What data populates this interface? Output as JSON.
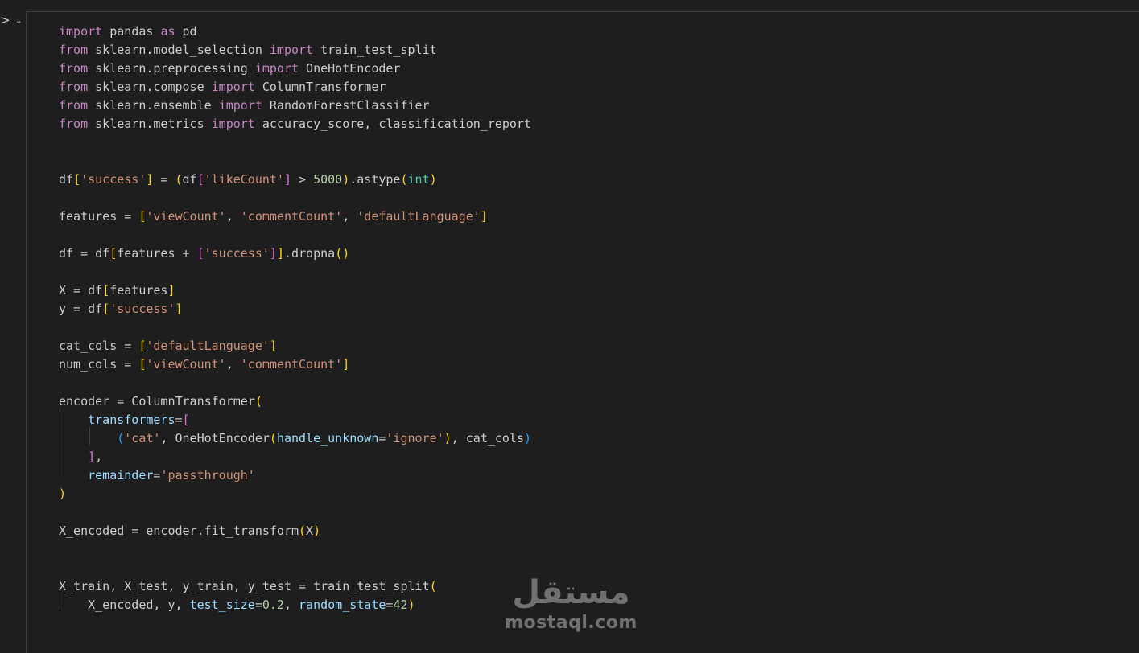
{
  "cell": {
    "run_icon": "execute-cell-icon",
    "run_glyph": ">",
    "expand_icon": "chevron-down-icon",
    "expand_glyph": "⌄"
  },
  "code": {
    "language": "python",
    "lines": [
      "import pandas as pd",
      "from sklearn.model_selection import train_test_split",
      "from sklearn.preprocessing import OneHotEncoder",
      "from sklearn.compose import ColumnTransformer",
      "from sklearn.ensemble import RandomForestClassifier",
      "from sklearn.metrics import accuracy_score, classification_report",
      "",
      "",
      "df['success'] = (df['likeCount'] > 5000).astype(int)",
      "",
      "features = ['viewCount', 'commentCount', 'defaultLanguage']",
      "",
      "df = df[features + ['success']].dropna()",
      "",
      "X = df[features]",
      "y = df['success']",
      "",
      "cat_cols = ['defaultLanguage']",
      "num_cols = ['viewCount', 'commentCount']",
      "",
      "encoder = ColumnTransformer(",
      "    transformers=[",
      "        ('cat', OneHotEncoder(handle_unknown='ignore'), cat_cols)",
      "    ],",
      "    remainder='passthrough'",
      ")",
      "",
      "X_encoded = encoder.fit_transform(X)",
      "",
      "",
      "X_train, X_test, y_train, y_test = train_test_split(",
      "    X_encoded, y, test_size=0.2, random_state=42)"
    ]
  },
  "watermark": {
    "arabic": "مستقل",
    "latin": "mostaql.com"
  },
  "colors": {
    "background": "#1f1f1f",
    "keyword": "#c586c0",
    "string": "#ce9178",
    "number": "#b5cea8",
    "parameter": "#9cdcfe",
    "builtin": "#4ec9b0"
  }
}
